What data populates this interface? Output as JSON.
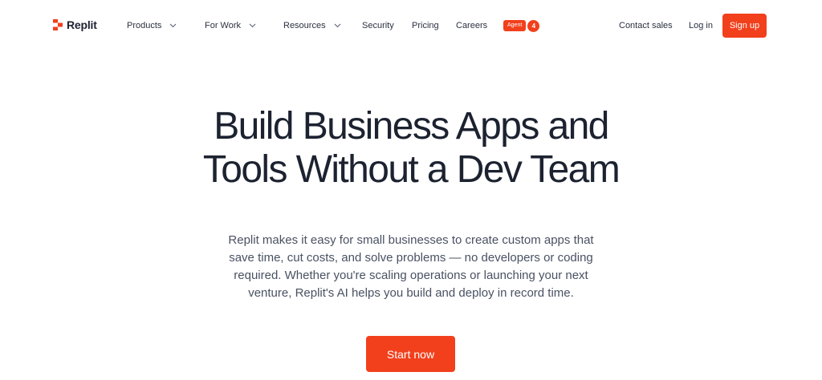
{
  "brand": {
    "name": "Replit",
    "accent_color": "#f2401c"
  },
  "nav": {
    "products": "Products",
    "for_work": "For Work",
    "resources": "Resources",
    "security": "Security",
    "pricing": "Pricing",
    "careers": "Careers",
    "agent_label": "Agent",
    "agent_count": "4",
    "contact_sales": "Contact sales",
    "log_in": "Log in",
    "sign_up": "Sign up"
  },
  "hero": {
    "title_line1": "Build Business Apps and",
    "title_line2": "Tools Without a Dev Team",
    "subtitle": "Replit makes it easy for small businesses to create custom apps that save time, cut costs, and solve problems — no developers or coding required. Whether you're scaling operations or launching your next venture, Replit's AI helps you build and deploy in record time.",
    "cta_label": "Start now"
  },
  "icons": {
    "logo": "replit-logo-icon",
    "dropdown": "chevron-down-icon"
  }
}
